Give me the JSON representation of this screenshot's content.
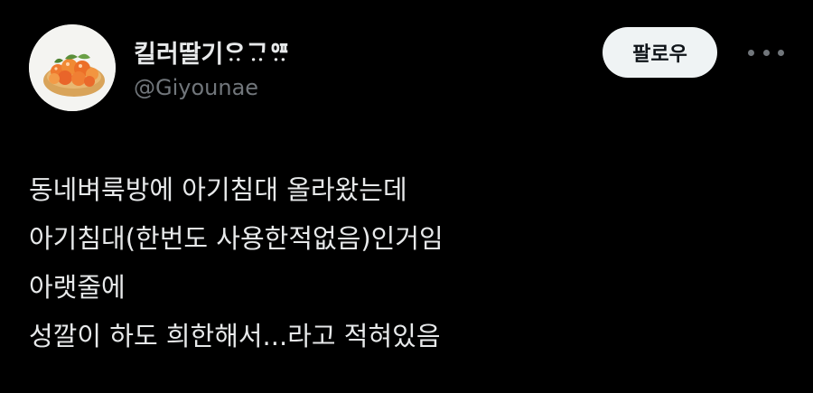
{
  "user": {
    "display_name": "킬러딸기ᄋᆢᄀᆢᅋᆢ",
    "handle": "@Giyounae",
    "avatar_icon": "strawberry-tart-avatar"
  },
  "actions": {
    "follow_label": "팔로우",
    "more_icon": "more-horizontal-icon"
  },
  "tweet": {
    "lines": [
      "동네벼룩방에 아기침대 올라왔는데",
      "아기침대(한번도 사용한적없음)인거임",
      "아랫줄에",
      "성깔이 하도 희한해서...라고 적혀있음"
    ]
  },
  "colors": {
    "background": "#000000",
    "text_primary": "#e7e9ea",
    "text_secondary": "#71767b",
    "button_bg": "#eff3f4",
    "button_text": "#0f1419"
  }
}
